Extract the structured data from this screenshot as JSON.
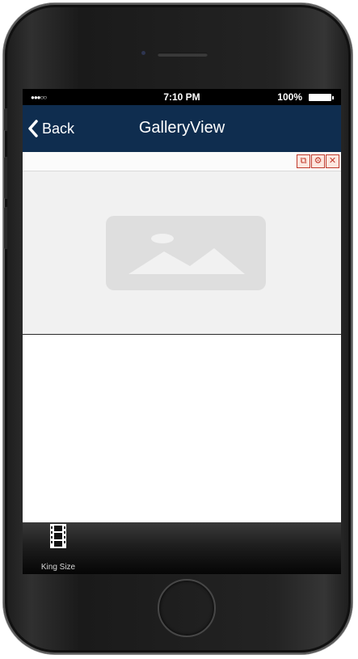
{
  "device": {
    "frame_color": "#1f1f1f"
  },
  "status_bar": {
    "signal": "●●●○○",
    "time": "7:10 PM",
    "battery_percent": "100%",
    "battery_level": 1.0
  },
  "nav_bar": {
    "back_label": "Back",
    "back_icon": "chevron-left-icon",
    "title": "GalleryView",
    "background_color": "#0f2d4f"
  },
  "toolbar": {
    "icons": [
      "copy-icon",
      "gear-icon",
      "close-icon"
    ],
    "copy_glyph": "⧉",
    "gear_glyph": "⚙",
    "close_glyph": "✕",
    "accent_color": "#c0392b"
  },
  "gallery": {
    "placeholder_icon": "image-placeholder-icon"
  },
  "tab_bar": {
    "items": [
      {
        "label": "King Size",
        "icon": "film-strip-icon"
      }
    ]
  }
}
